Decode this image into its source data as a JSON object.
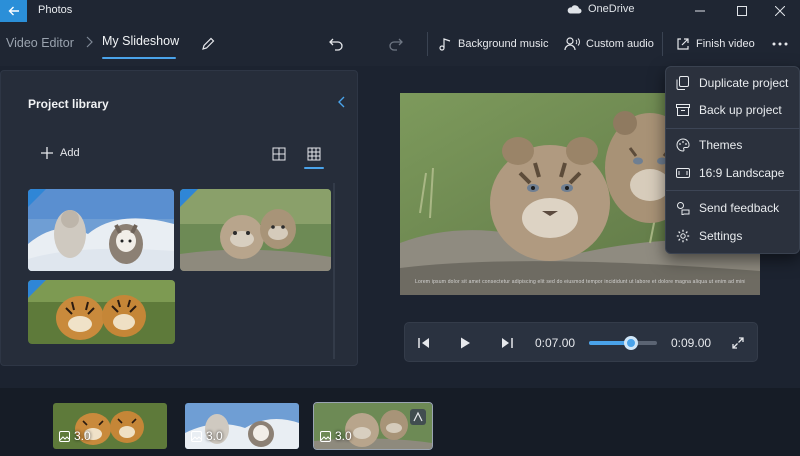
{
  "app": {
    "title": "Photos",
    "onedrive_label": "OneDrive"
  },
  "toolbar": {
    "breadcrumb_root": "Video Editor",
    "project_name": "My Slideshow",
    "background_music_label": "Background music",
    "custom_audio_label": "Custom audio",
    "finish_video_label": "Finish video"
  },
  "library": {
    "title": "Project library",
    "add_label": "Add"
  },
  "preview": {
    "caption": "Lorem ipsum dolor sit amet consectetur adipiscing elit sed do eiusmod tempor incididunt ut labore et dolore magna aliqua ut enim ad minim veniam"
  },
  "player": {
    "current_time": "0:07.00",
    "total_time": "0:09.00",
    "progress": 0.62
  },
  "storyboard": {
    "items": [
      {
        "duration": "3.0"
      },
      {
        "duration": "3.0"
      },
      {
        "duration": "3.0"
      }
    ]
  },
  "menu": {
    "items": [
      {
        "label": "Duplicate project",
        "icon": "duplicate-icon"
      },
      {
        "label": "Back up project",
        "icon": "backup-icon"
      },
      {
        "label": "Themes",
        "icon": "themes-icon"
      },
      {
        "label": "16:9 Landscape",
        "icon": "aspect-ratio-icon"
      },
      {
        "label": "Send feedback",
        "icon": "feedback-icon"
      },
      {
        "label": "Settings",
        "icon": "settings-icon"
      }
    ]
  },
  "colors": {
    "accent": "#4aa3ea",
    "back_button": "#2b8fd8",
    "background": "#1c2330"
  }
}
